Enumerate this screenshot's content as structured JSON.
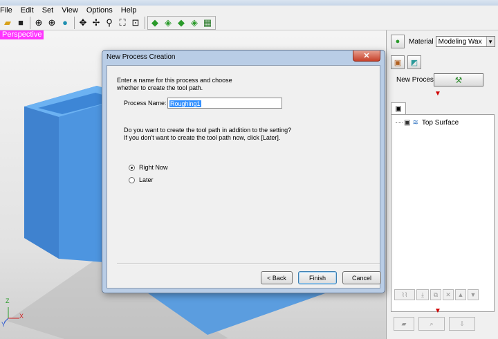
{
  "menubar": {
    "items": [
      "File",
      "Edit",
      "Set",
      "View",
      "Options",
      "Help"
    ]
  },
  "toolbar": {
    "icons": [
      "open-icon",
      "save-icon",
      "target-icon",
      "crosshair-icon",
      "sphere-icon",
      "pan-icon",
      "move-icon",
      "zoom-icon",
      "zoom-fit-icon",
      "zoom-window-icon",
      "green-cube-icon",
      "cube-arrow-icon",
      "cube-side-icon",
      "cube-rotate-icon",
      "grid-icon"
    ]
  },
  "viewport": {
    "view_label": "Perspective",
    "axis_x": "X",
    "axis_y": "Y",
    "axis_z": "Z"
  },
  "panel": {
    "material_label": "Material",
    "material_value": "Modeling Wax",
    "new_process_label": "New Process",
    "tree_item": "Top Surface"
  },
  "dialog": {
    "title": "New Process Creation",
    "close_symbol": "✕",
    "intro_line1": "Enter a name for this process and choose",
    "intro_line2": "whether to create the tool path.",
    "process_name_label": "Process Name:",
    "process_name_value": "Roughing1",
    "question_line1": "Do you want to create the tool path in addition to the setting?",
    "question_line2": "If you don't want to create the tool path now, click [Later].",
    "option_now": "Right Now",
    "option_later": "Later",
    "selected_option": "Right Now",
    "back_button": "< Back",
    "finish_button": "Finish",
    "cancel_button": "Cancel"
  },
  "colors": {
    "view_label_bg": "#ff33ff",
    "model_blue": "#4a90dd",
    "dialog_frame": "#b9cde6"
  }
}
